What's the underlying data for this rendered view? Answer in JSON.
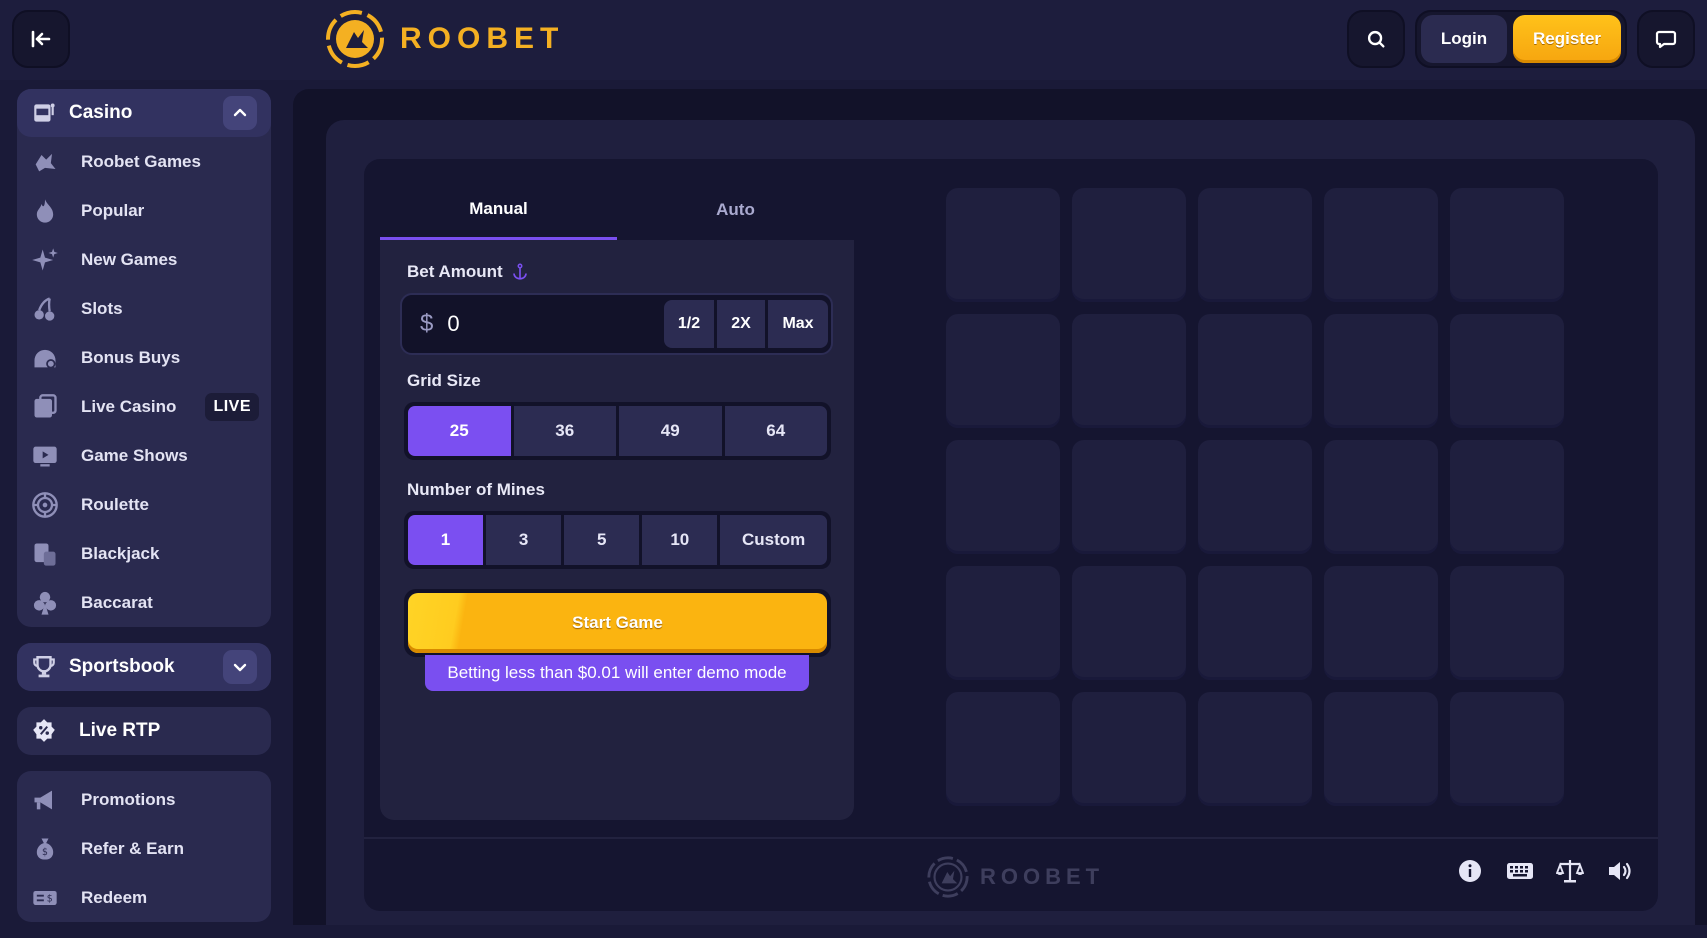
{
  "brand": {
    "name": "ROOBET",
    "accent": "#f4b022",
    "purple": "#7a4ff0"
  },
  "header": {
    "login_label": "Login",
    "register_label": "Register"
  },
  "sidebar": {
    "casino": {
      "title": "Casino",
      "items": [
        {
          "label": "Roobet Games",
          "icon": "roobet-games-icon"
        },
        {
          "label": "Popular",
          "icon": "flame-icon"
        },
        {
          "label": "New Games",
          "icon": "sparkle-icon"
        },
        {
          "label": "Slots",
          "icon": "cherries-icon"
        },
        {
          "label": "Bonus Buys",
          "icon": "bonus-buys-icon"
        },
        {
          "label": "Live Casino",
          "icon": "live-casino-icon",
          "badge": "LIVE"
        },
        {
          "label": "Game Shows",
          "icon": "tv-icon"
        },
        {
          "label": "Roulette",
          "icon": "roulette-icon"
        },
        {
          "label": "Blackjack",
          "icon": "cards-icon"
        },
        {
          "label": "Baccarat",
          "icon": "club-icon"
        }
      ]
    },
    "sportsbook": {
      "title": "Sportsbook"
    },
    "live_rtp": {
      "title": "Live RTP"
    },
    "misc": {
      "items": [
        {
          "label": "Promotions",
          "icon": "megaphone-icon"
        },
        {
          "label": "Refer & Earn",
          "icon": "money-bag-icon"
        },
        {
          "label": "Redeem",
          "icon": "voucher-icon"
        }
      ]
    }
  },
  "game": {
    "tabs": [
      "Manual",
      "Auto"
    ],
    "active_tab": "Manual",
    "bet_amount": {
      "label": "Bet Amount",
      "currency": "$",
      "value": "0",
      "buttons": [
        "1/2",
        "2X",
        "Max"
      ]
    },
    "grid_size": {
      "label": "Grid Size",
      "options": [
        "25",
        "36",
        "49",
        "64"
      ],
      "selected": "25"
    },
    "mines": {
      "label": "Number of Mines",
      "options": [
        "1",
        "3",
        "5",
        "10",
        "Custom"
      ],
      "selected": "1"
    },
    "start_label": "Start Game",
    "demo_note": "Betting less than $0.01 will enter demo mode",
    "tiles_count": 25
  },
  "footer": {
    "logo_text": "ROOBET"
  }
}
